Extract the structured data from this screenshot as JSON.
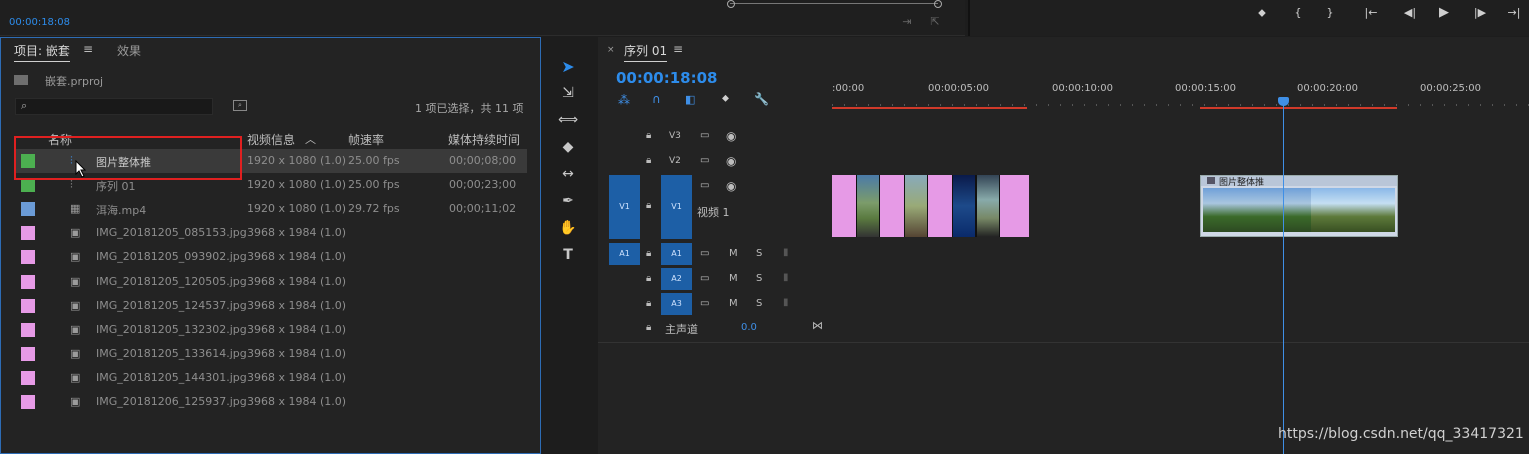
{
  "top_bar": {
    "source_timecode": "00:00:18:08"
  },
  "project_panel": {
    "tab_project": "项目: 嵌套",
    "tab_effects": "效果",
    "project_file": "嵌套.prproj",
    "search_placeholder": "",
    "selection_status": "1 项已选择，共 11 项",
    "columns": {
      "name": "名称",
      "video_info": "视频信息",
      "frame_rate": "帧速率",
      "media_duration": "媒体持续时间"
    },
    "items": [
      {
        "name": "图片整体推",
        "video_info": "1920 x 1080 (1.0)",
        "frame_rate": "25.00 fps",
        "duration": "00;00;08;00",
        "color": "#4caf50",
        "icon": "sequence-icon",
        "selected": true
      },
      {
        "name": "序列 01",
        "video_info": "1920 x 1080 (1.0)",
        "frame_rate": "25.00 fps",
        "duration": "00;00;23;00",
        "color": "#4caf50",
        "icon": "sequence-icon",
        "selected": false
      },
      {
        "name": "洱海.mp4",
        "video_info": "1920 x 1080 (1.0)",
        "frame_rate": "29.72 fps",
        "duration": "00;00;11;02",
        "color": "#6b9bd6",
        "icon": "video-clip-icon",
        "selected": false
      },
      {
        "name": "IMG_20181205_085153.jpg",
        "video_info": "3968 x 1984 (1.0)",
        "frame_rate": "",
        "duration": "",
        "color": "#e69ae6",
        "icon": "image-file-icon",
        "selected": false
      },
      {
        "name": "IMG_20181205_093902.jpg",
        "video_info": "3968 x 1984 (1.0)",
        "frame_rate": "",
        "duration": "",
        "color": "#e69ae6",
        "icon": "image-file-icon",
        "selected": false
      },
      {
        "name": "IMG_20181205_120505.jpg",
        "video_info": "3968 x 1984 (1.0)",
        "frame_rate": "",
        "duration": "",
        "color": "#e69ae6",
        "icon": "image-file-icon",
        "selected": false
      },
      {
        "name": "IMG_20181205_124537.jpg",
        "video_info": "3968 x 1984 (1.0)",
        "frame_rate": "",
        "duration": "",
        "color": "#e69ae6",
        "icon": "image-file-icon",
        "selected": false
      },
      {
        "name": "IMG_20181205_132302.jpg",
        "video_info": "3968 x 1984 (1.0)",
        "frame_rate": "",
        "duration": "",
        "color": "#e69ae6",
        "icon": "image-file-icon",
        "selected": false
      },
      {
        "name": "IMG_20181205_133614.jpg",
        "video_info": "3968 x 1984 (1.0)",
        "frame_rate": "",
        "duration": "",
        "color": "#e69ae6",
        "icon": "image-file-icon",
        "selected": false
      },
      {
        "name": "IMG_20181205_144301.jpg",
        "video_info": "3968 x 1984 (1.0)",
        "frame_rate": "",
        "duration": "",
        "color": "#e69ae6",
        "icon": "image-file-icon",
        "selected": false
      },
      {
        "name": "IMG_20181206_125937.jpg",
        "video_info": "3968 x 1984 (1.0)",
        "frame_rate": "",
        "duration": "",
        "color": "#e69ae6",
        "icon": "image-file-icon",
        "selected": false
      }
    ]
  },
  "timeline": {
    "tab_label": "序列 01",
    "current_timecode": "00:00:18:08",
    "ruler_labels": [
      ":00:00",
      "00:00:05:00",
      "00:00:10:00",
      "00:00:15:00",
      "00:00:20:00",
      "00:00:25:00"
    ],
    "tracks": {
      "v3": "V3",
      "v2": "V2",
      "v1": "V1",
      "v1_source": "V1",
      "v1_name": "视频 1",
      "a1": "A1",
      "a1_source": "A1",
      "a2": "A2",
      "a3": "A3",
      "mute": "M",
      "solo": "S",
      "master_label": "主声道",
      "master_value": "0.0"
    },
    "nested_clip_label": "图片整体推"
  },
  "watermark": "https://blog.csdn.net/qq_33417321",
  "colors": {
    "accent": "#2d8ceb",
    "selection_box": "#e02020",
    "in_out_bar": "#d03a2a"
  }
}
